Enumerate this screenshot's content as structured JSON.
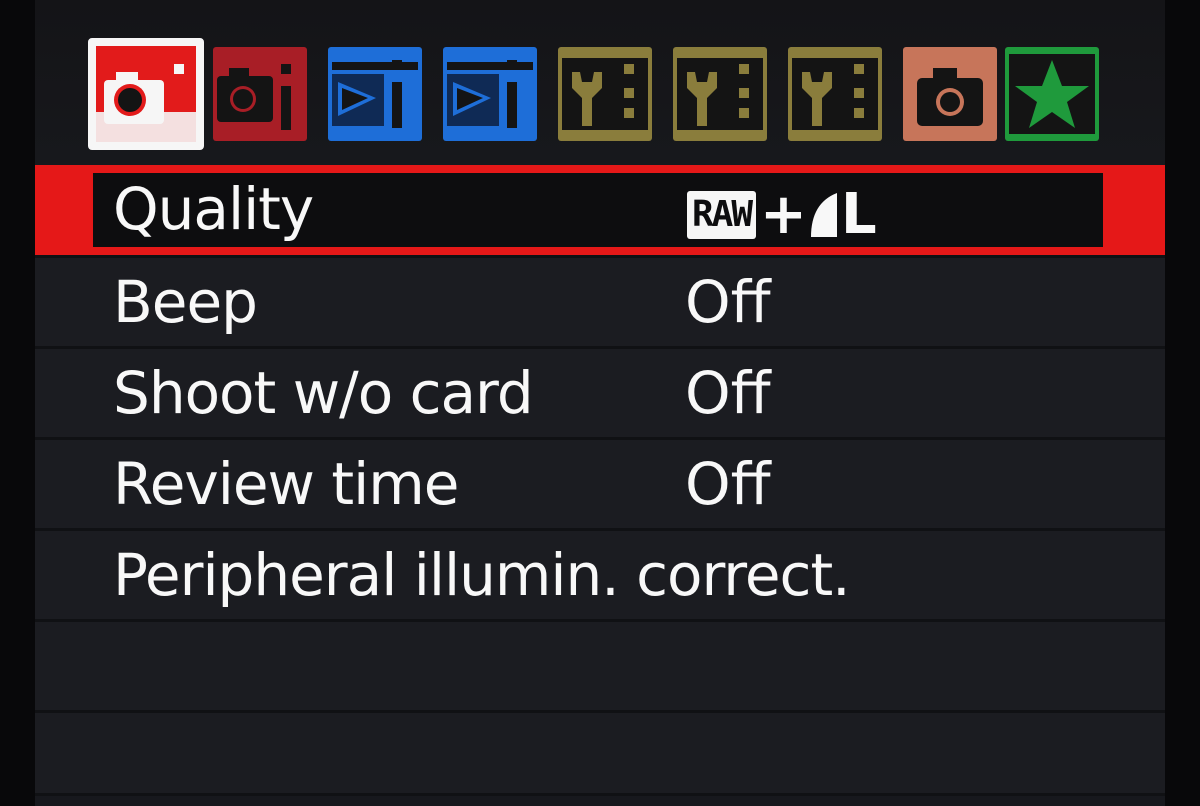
{
  "tabs": [
    {
      "id": "shoot1",
      "icon": "camera-icon",
      "color": "#e21b1b",
      "active": true
    },
    {
      "id": "shoot2",
      "icon": "camera-icon",
      "color": "#a81e26",
      "active": false
    },
    {
      "id": "playback1",
      "icon": "playback-icon",
      "color": "#1e6ed8",
      "active": false
    },
    {
      "id": "playback2",
      "icon": "playback-icon",
      "color": "#1e6ed8",
      "active": false
    },
    {
      "id": "setup1",
      "icon": "wrench-icon",
      "color": "#8a7d3c",
      "active": false
    },
    {
      "id": "setup2",
      "icon": "wrench-icon",
      "color": "#8a7d3c",
      "active": false
    },
    {
      "id": "setup3",
      "icon": "wrench-icon",
      "color": "#8a7d3c",
      "active": false
    },
    {
      "id": "custom",
      "icon": "camera-icon",
      "color": "#c7755a",
      "active": false
    },
    {
      "id": "mymenu",
      "icon": "star-icon",
      "color": "#1f9a3c",
      "active": false
    }
  ],
  "menu": {
    "items": [
      {
        "label": "Quality",
        "value_badge": "RAW",
        "value_plus": "+",
        "value_size": "L",
        "selected": true
      },
      {
        "label": "Beep",
        "value": "Off"
      },
      {
        "label": "Shoot w/o card",
        "value": "Off"
      },
      {
        "label": "Review time",
        "value": "Off"
      },
      {
        "label": "Peripheral illumin. correct.",
        "value": ""
      }
    ]
  },
  "colors": {
    "selection": "#e51818",
    "background": "#1b1c21",
    "text": "#f8f8f8"
  }
}
